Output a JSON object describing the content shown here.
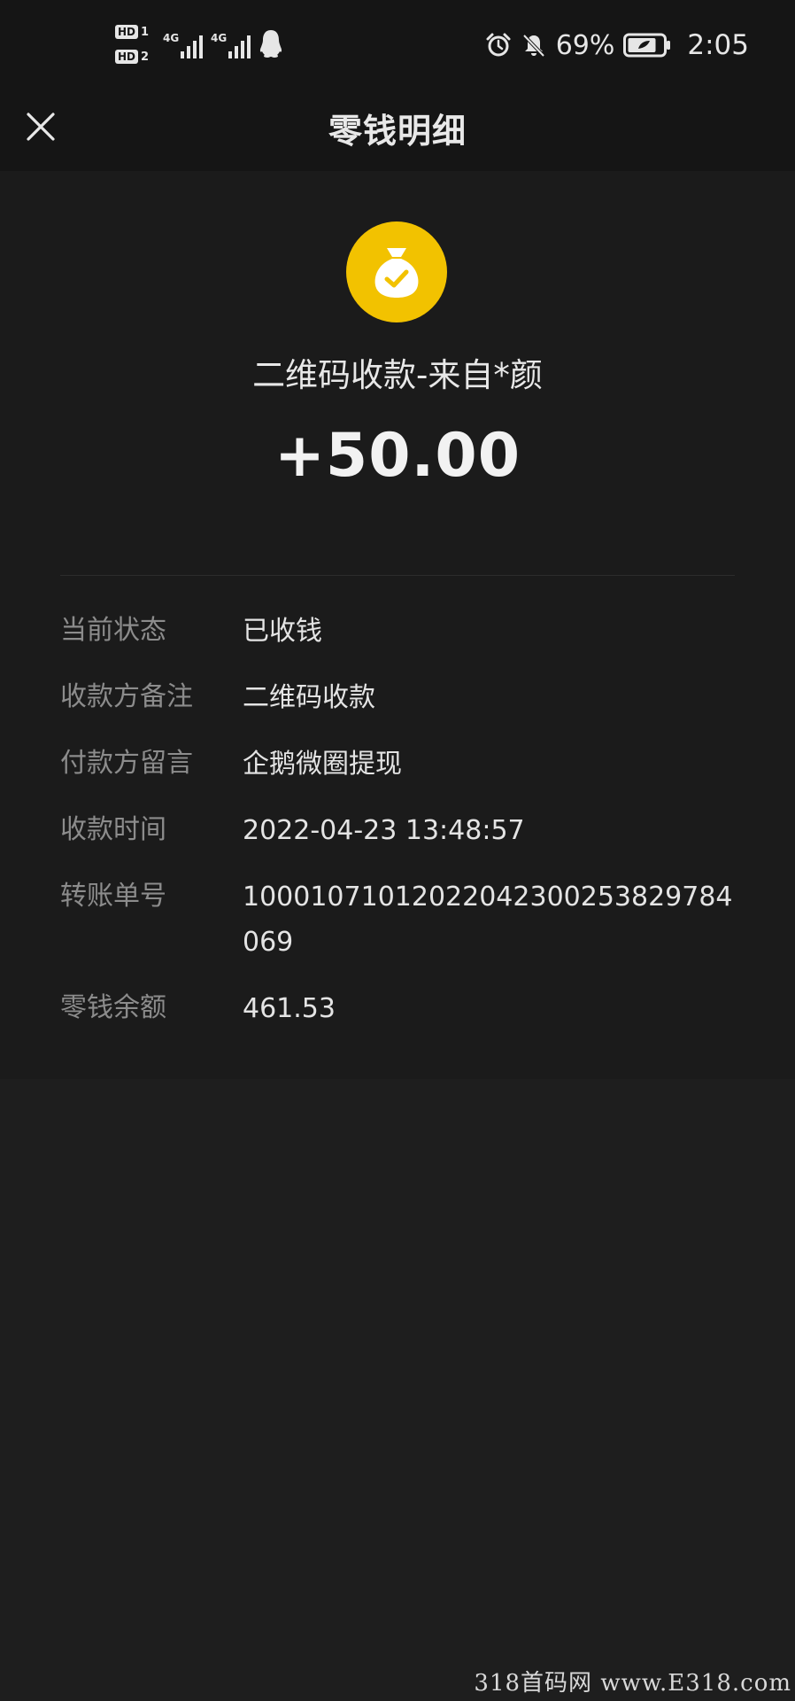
{
  "status_bar": {
    "sim1_badge": "HD",
    "sim1_num": "1",
    "sim2_badge": "HD",
    "sim2_num": "2",
    "network1": "4G",
    "network2": "4G",
    "battery": "69%",
    "time": "2:05",
    "icons": [
      "alarm-icon",
      "bell-muted-icon",
      "battery-icon",
      "qq-icon"
    ]
  },
  "header": {
    "title": "零钱明细",
    "close_icon": "close-icon"
  },
  "transaction": {
    "title": "二维码收款-来自*颜",
    "amount": "+50.00",
    "icon": "money-bag-check-icon",
    "accent_color": "#f2c200"
  },
  "details": [
    {
      "label": "当前状态",
      "value": "已收钱"
    },
    {
      "label": "收款方备注",
      "value": "二维码收款"
    },
    {
      "label": "付款方留言",
      "value": "企鹅微圈提现"
    },
    {
      "label": "收款时间",
      "value": "2022-04-23 13:48:57"
    },
    {
      "label": "转账单号",
      "value": "10001071012022042300253829784069"
    },
    {
      "label": "零钱余额",
      "value": "461.53"
    }
  ],
  "watermark": "318首码网 www.E318.com"
}
